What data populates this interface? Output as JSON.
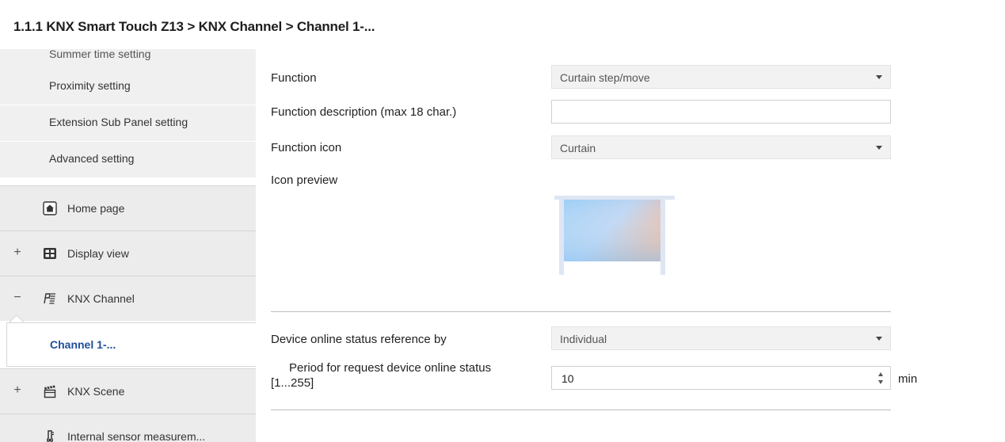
{
  "header": {
    "breadcrumb": "1.1.1 KNX Smart Touch Z13 > KNX Channel  > Channel 1-..."
  },
  "sidebar": {
    "sub_items": [
      {
        "label": "Summer time setting"
      },
      {
        "label": "Proximity setting"
      },
      {
        "label": "Extension Sub Panel setting"
      },
      {
        "label": "Advanced setting"
      }
    ],
    "groups": [
      {
        "label": "Home page",
        "expander": "",
        "icon": "home-icon"
      },
      {
        "label": "Display view",
        "expander": "+",
        "icon": "display-grid-icon"
      },
      {
        "label": "KNX Channel",
        "expander": "−",
        "icon": "knx-channel-icon"
      },
      {
        "label": "KNX Scene",
        "expander": "+",
        "icon": "scene-clapper-icon"
      },
      {
        "label": "Internal sensor measurem...",
        "expander": "",
        "icon": "thermometer-icon"
      }
    ],
    "selected_item": {
      "label": "Channel 1-..."
    }
  },
  "form": {
    "function": {
      "label": "Function",
      "value": "Curtain step/move"
    },
    "description": {
      "label": "Function description (max 18 char.)",
      "value": ""
    },
    "icon": {
      "label": "Function icon",
      "value": "Curtain"
    },
    "icon_preview": {
      "label": "Icon preview",
      "icon": "curtain-preview-icon"
    },
    "online_ref": {
      "label": "Device online status reference by",
      "value": "Individual"
    },
    "period": {
      "label_line1": "Period for request device online status",
      "label_line2": "[1...255]",
      "value": "10",
      "unit": "min"
    }
  },
  "colors": {
    "selected_text": "#1f4e9c",
    "sidebar_bg": "#ececec"
  }
}
